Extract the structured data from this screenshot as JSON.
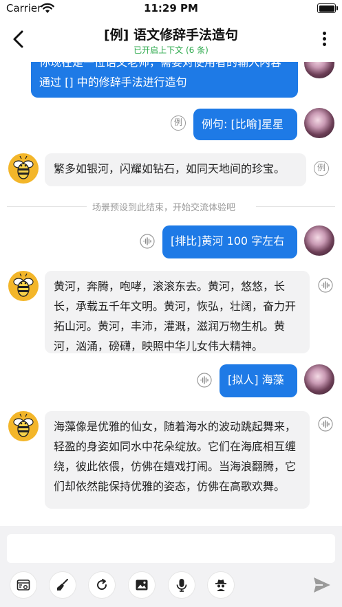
{
  "status": {
    "carrier": "Carrier",
    "time": "11:29 PM"
  },
  "nav": {
    "title": "[例] 语文修辞手法造句",
    "subtitle": "已开启上下文 (6 条)"
  },
  "messages": {
    "m1": "你现在是一位语文老师，需要对使用者的输入内容通过 [] 中的修辞手法进行造句",
    "m2": "例句: [比喻]星星",
    "m3": "繁多如银河，闪耀如钻石，如同天地间的珍宝。",
    "divider": "场景预设到此结束，开始交流体验吧",
    "m4": "[排比]黄河 100 字左右",
    "m5": "黄河，奔腾，咆哮，滚滚东去。黄河，悠悠，长长，承载五千年文明。黄河，恢弘，壮阔，奋力开拓山河。黄河，丰沛，灌溉，滋润万物生机。黄河，汹涌，磅礴，映照中华儿女伟大精神。",
    "m6": "[拟人] 海藻",
    "m7": "海藻像是优雅的仙女，随着海水的波动跳起舞来，轻盈的身姿如同水中花朵绽放。它们在海底相互缠绕，彼此依偎，仿佛在嬉戏打闹。当海浪翻腾，它们却依然能保持优雅的姿态，仿佛在高歌欢舞。"
  },
  "badges": {
    "example": "例"
  },
  "input": {
    "placeholder": ""
  },
  "colors": {
    "accent": "#1e7ae6",
    "context_green": "#2aa84a",
    "bee": "#f3b62a"
  },
  "icons": [
    "back-icon",
    "more-icon",
    "wifi-icon",
    "battery-icon",
    "voice-icon",
    "bee-icon",
    "settings-icon",
    "broom-icon",
    "refresh-icon",
    "image-icon",
    "mic-icon",
    "spy-icon",
    "send-icon"
  ]
}
